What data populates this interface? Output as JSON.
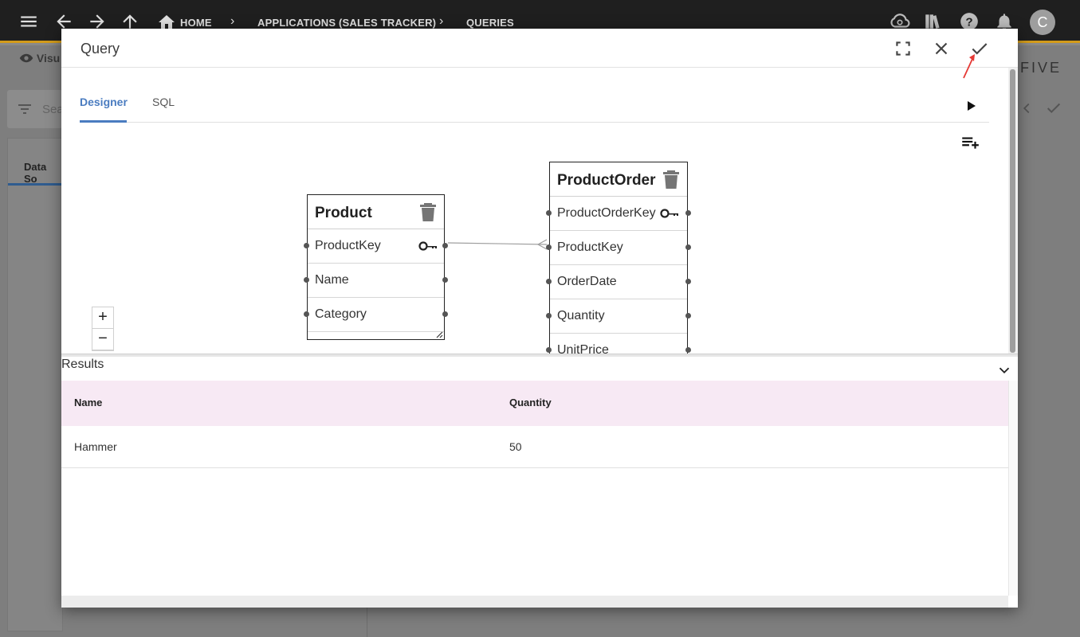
{
  "nav": {
    "breadcrumb_home": "HOME",
    "breadcrumb_app": "APPLICATIONS (SALES TRACKER)",
    "breadcrumb_queries": "QUERIES",
    "avatar_initial": "C"
  },
  "background": {
    "visual_label": "Visu",
    "search_placeholder": "Sea",
    "panel_tab": "Data So",
    "logo": "FIVE"
  },
  "modal": {
    "title": "Query",
    "tabs": [
      {
        "label": "Designer",
        "active": true
      },
      {
        "label": "SQL",
        "active": false
      }
    ]
  },
  "diagram": {
    "tables": [
      {
        "name": "Product",
        "fields": [
          {
            "label": "ProductKey",
            "key": true
          },
          {
            "label": "Name",
            "key": false
          },
          {
            "label": "Category",
            "key": false
          }
        ]
      },
      {
        "name": "ProductOrder",
        "fields": [
          {
            "label": "ProductOrderKey",
            "key": true
          },
          {
            "label": "ProductKey",
            "key": false
          },
          {
            "label": "OrderDate",
            "key": false
          },
          {
            "label": "Quantity",
            "key": false
          },
          {
            "label": "UnitPrice",
            "key": false
          }
        ]
      }
    ],
    "zoom_in": "+",
    "zoom_out": "−"
  },
  "results": {
    "label": "Results",
    "columns": [
      "Name",
      "Quantity"
    ],
    "rows": [
      [
        "Hammer",
        "50"
      ]
    ]
  },
  "colors": {
    "accent": "#4a7cc0",
    "header_row": "#f7e9f4",
    "topbar": "#1f1f1f",
    "topbar_border": "#d29b1a",
    "annotation": "#e53935"
  },
  "icons": [
    "menu-icon",
    "back-icon",
    "forward-icon",
    "up-icon",
    "home-icon",
    "cloud-icon",
    "library-icon",
    "help-icon",
    "bell-icon",
    "fullscreen-icon",
    "close-icon",
    "check-icon",
    "play-icon",
    "playlist-add-icon",
    "trash-icon",
    "key-icon",
    "chevron-down-icon"
  ]
}
